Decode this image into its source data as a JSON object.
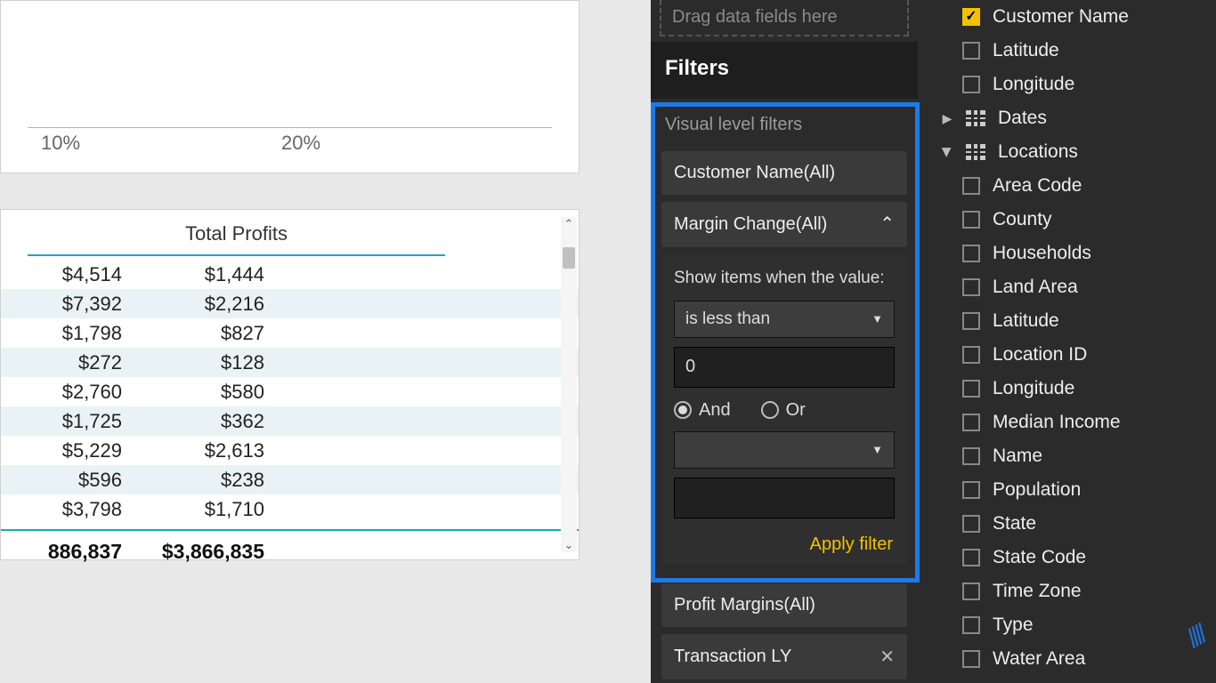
{
  "chart": {
    "ticks": [
      "10%",
      "20%"
    ]
  },
  "table": {
    "header": "Total Profits",
    "rows": [
      {
        "c1": "$4,514",
        "c2": "$1,444"
      },
      {
        "c1": "$7,392",
        "c2": "$2,216"
      },
      {
        "c1": "$1,798",
        "c2": "$827"
      },
      {
        "c1": "$272",
        "c2": "$128"
      },
      {
        "c1": "$2,760",
        "c2": "$580"
      },
      {
        "c1": "$1,725",
        "c2": "$362"
      },
      {
        "c1": "$5,229",
        "c2": "$2,613"
      },
      {
        "c1": "$596",
        "c2": "$238"
      },
      {
        "c1": "$3,798",
        "c2": "$1,710"
      }
    ],
    "total": {
      "c1": "886,837",
      "c2": "$3,866,835"
    }
  },
  "viz_pane": {
    "drag_hint": "Drag data fields here",
    "filters_header": "Filters",
    "section_label": "Visual level filters",
    "filter1_label": "Customer Name(All)",
    "filter2_label": "Margin Change(All)",
    "show_items_label": "Show items when the value:",
    "condition1": "is less than",
    "value1": "0",
    "and_label": "And",
    "or_label": "Or",
    "condition2": "",
    "value2": "",
    "apply_label": "Apply filter",
    "filter3_label": "Profit Margins(All)",
    "filter4_label": "Transaction LY"
  },
  "fields": {
    "top_checked": "Customer Name",
    "top2": "Latitude",
    "top3": "Longitude",
    "table_dates": "Dates",
    "table_locations": "Locations",
    "loc_items": [
      "Area Code",
      "County",
      "Households",
      "Land Area",
      "Latitude",
      "Location ID",
      "Longitude",
      "Median Income",
      "Name",
      "Population",
      "State",
      "State Code",
      "Time Zone",
      "Type",
      "Water Area"
    ]
  }
}
